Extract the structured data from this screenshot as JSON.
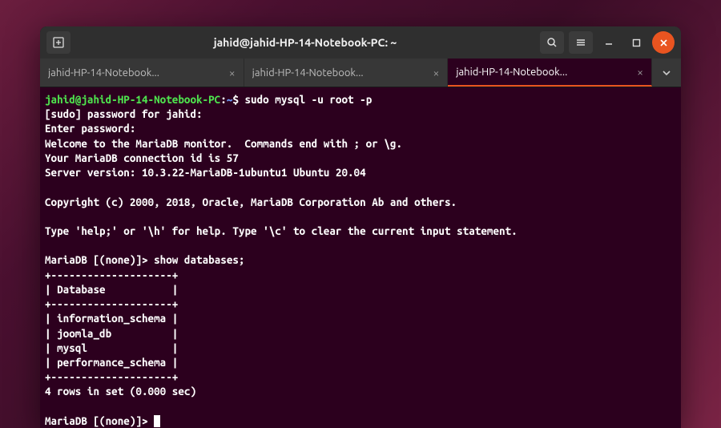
{
  "title": "jahid@jahid-HP-14-Notebook-PC: ~",
  "tabs": [
    {
      "label": "jahid-HP-14-Notebook...",
      "active": false
    },
    {
      "label": "jahid-HP-14-Notebook...",
      "active": false
    },
    {
      "label": "jahid-HP-14-Notebook...",
      "active": true
    }
  ],
  "prompt": {
    "userhost": "jahid@jahid-HP-14-Notebook-PC",
    "sep": ":",
    "cwd": "~",
    "sigil": "$"
  },
  "command": "sudo mysql -u root -p",
  "lines": {
    "sudo": "[sudo] password for jahid:",
    "enter": "Enter password:",
    "welcome": "Welcome to the MariaDB monitor.  Commands end with ; or \\g.",
    "connid": "Your MariaDB connection id is 57",
    "server": "Server version: 10.3.22-MariaDB-1ubuntu1 Ubuntu 20.04",
    "copyright": "Copyright (c) 2000, 2018, Oracle, MariaDB Corporation Ab and others.",
    "help": "Type 'help;' or '\\h' for help. Type '\\c' to clear the current input statement.",
    "mariadb_prompt": "MariaDB [(none)]>",
    "show_cmd": "show databases;",
    "border": "+--------------------+",
    "header_row": "| Database           |",
    "row1": "| information_schema |",
    "row2": "| joomla_db          |",
    "row3": "| mysql              |",
    "row4": "| performance_schema |",
    "rowcount": "4 rows in set (0.000 sec)"
  },
  "chart_data": {
    "type": "table",
    "title": "show databases;",
    "columns": [
      "Database"
    ],
    "rows": [
      [
        "information_schema"
      ],
      [
        "joomla_db"
      ],
      [
        "mysql"
      ],
      [
        "performance_schema"
      ]
    ],
    "row_count": 4,
    "elapsed_sec": 0.0
  }
}
